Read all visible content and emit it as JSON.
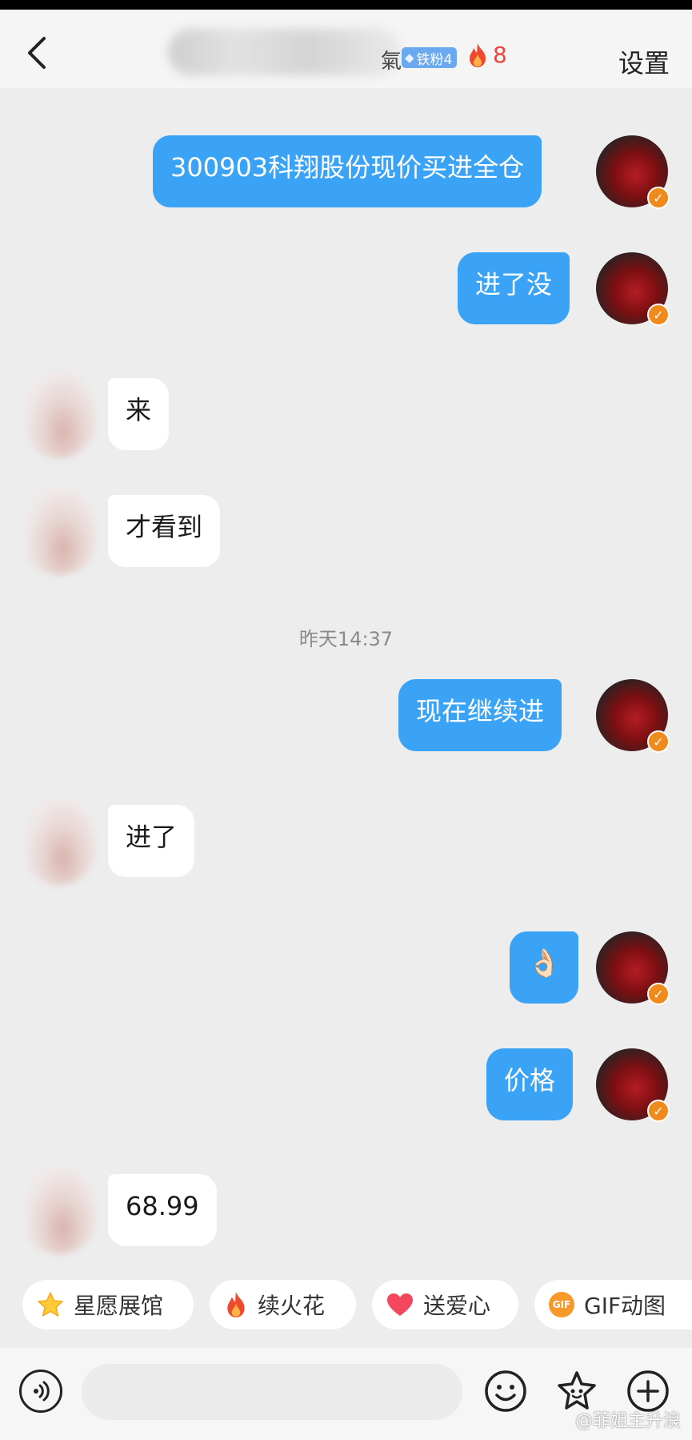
{
  "header": {
    "name_tail": "氣",
    "fan_badge": "铁粉4",
    "flame_count": "8",
    "settings_label": "设置"
  },
  "messages": [
    {
      "side": "out",
      "text": "300903科翔股份现价买进全仓"
    },
    {
      "side": "out",
      "text": "进了没"
    },
    {
      "side": "in",
      "text": "来"
    },
    {
      "side": "in",
      "text": "才看到"
    },
    {
      "side": "out",
      "text": "现在继续进"
    },
    {
      "side": "in",
      "text": "进了"
    },
    {
      "side": "out",
      "text": "👌🏻"
    },
    {
      "side": "out",
      "text": "价格"
    },
    {
      "side": "in",
      "text": "68.99"
    }
  ],
  "timestamp": "昨天14:37",
  "quick_actions": [
    {
      "label": "星愿展馆",
      "icon": "star-icon"
    },
    {
      "label": "续火花",
      "icon": "flame-icon"
    },
    {
      "label": "送爱心",
      "icon": "heart-icon"
    },
    {
      "label": "GIF动图",
      "icon": "gif-icon"
    }
  ],
  "input": {
    "placeholder": ""
  },
  "watermark": "@菲姐主升浪",
  "colors": {
    "outgoing_bubble": "#3aa3f6",
    "incoming_bubble": "#ffffff",
    "background": "#ededed",
    "flame": "#e9453b",
    "fan_badge": "#6aa8f0",
    "verified_badge": "#f08a1c"
  }
}
